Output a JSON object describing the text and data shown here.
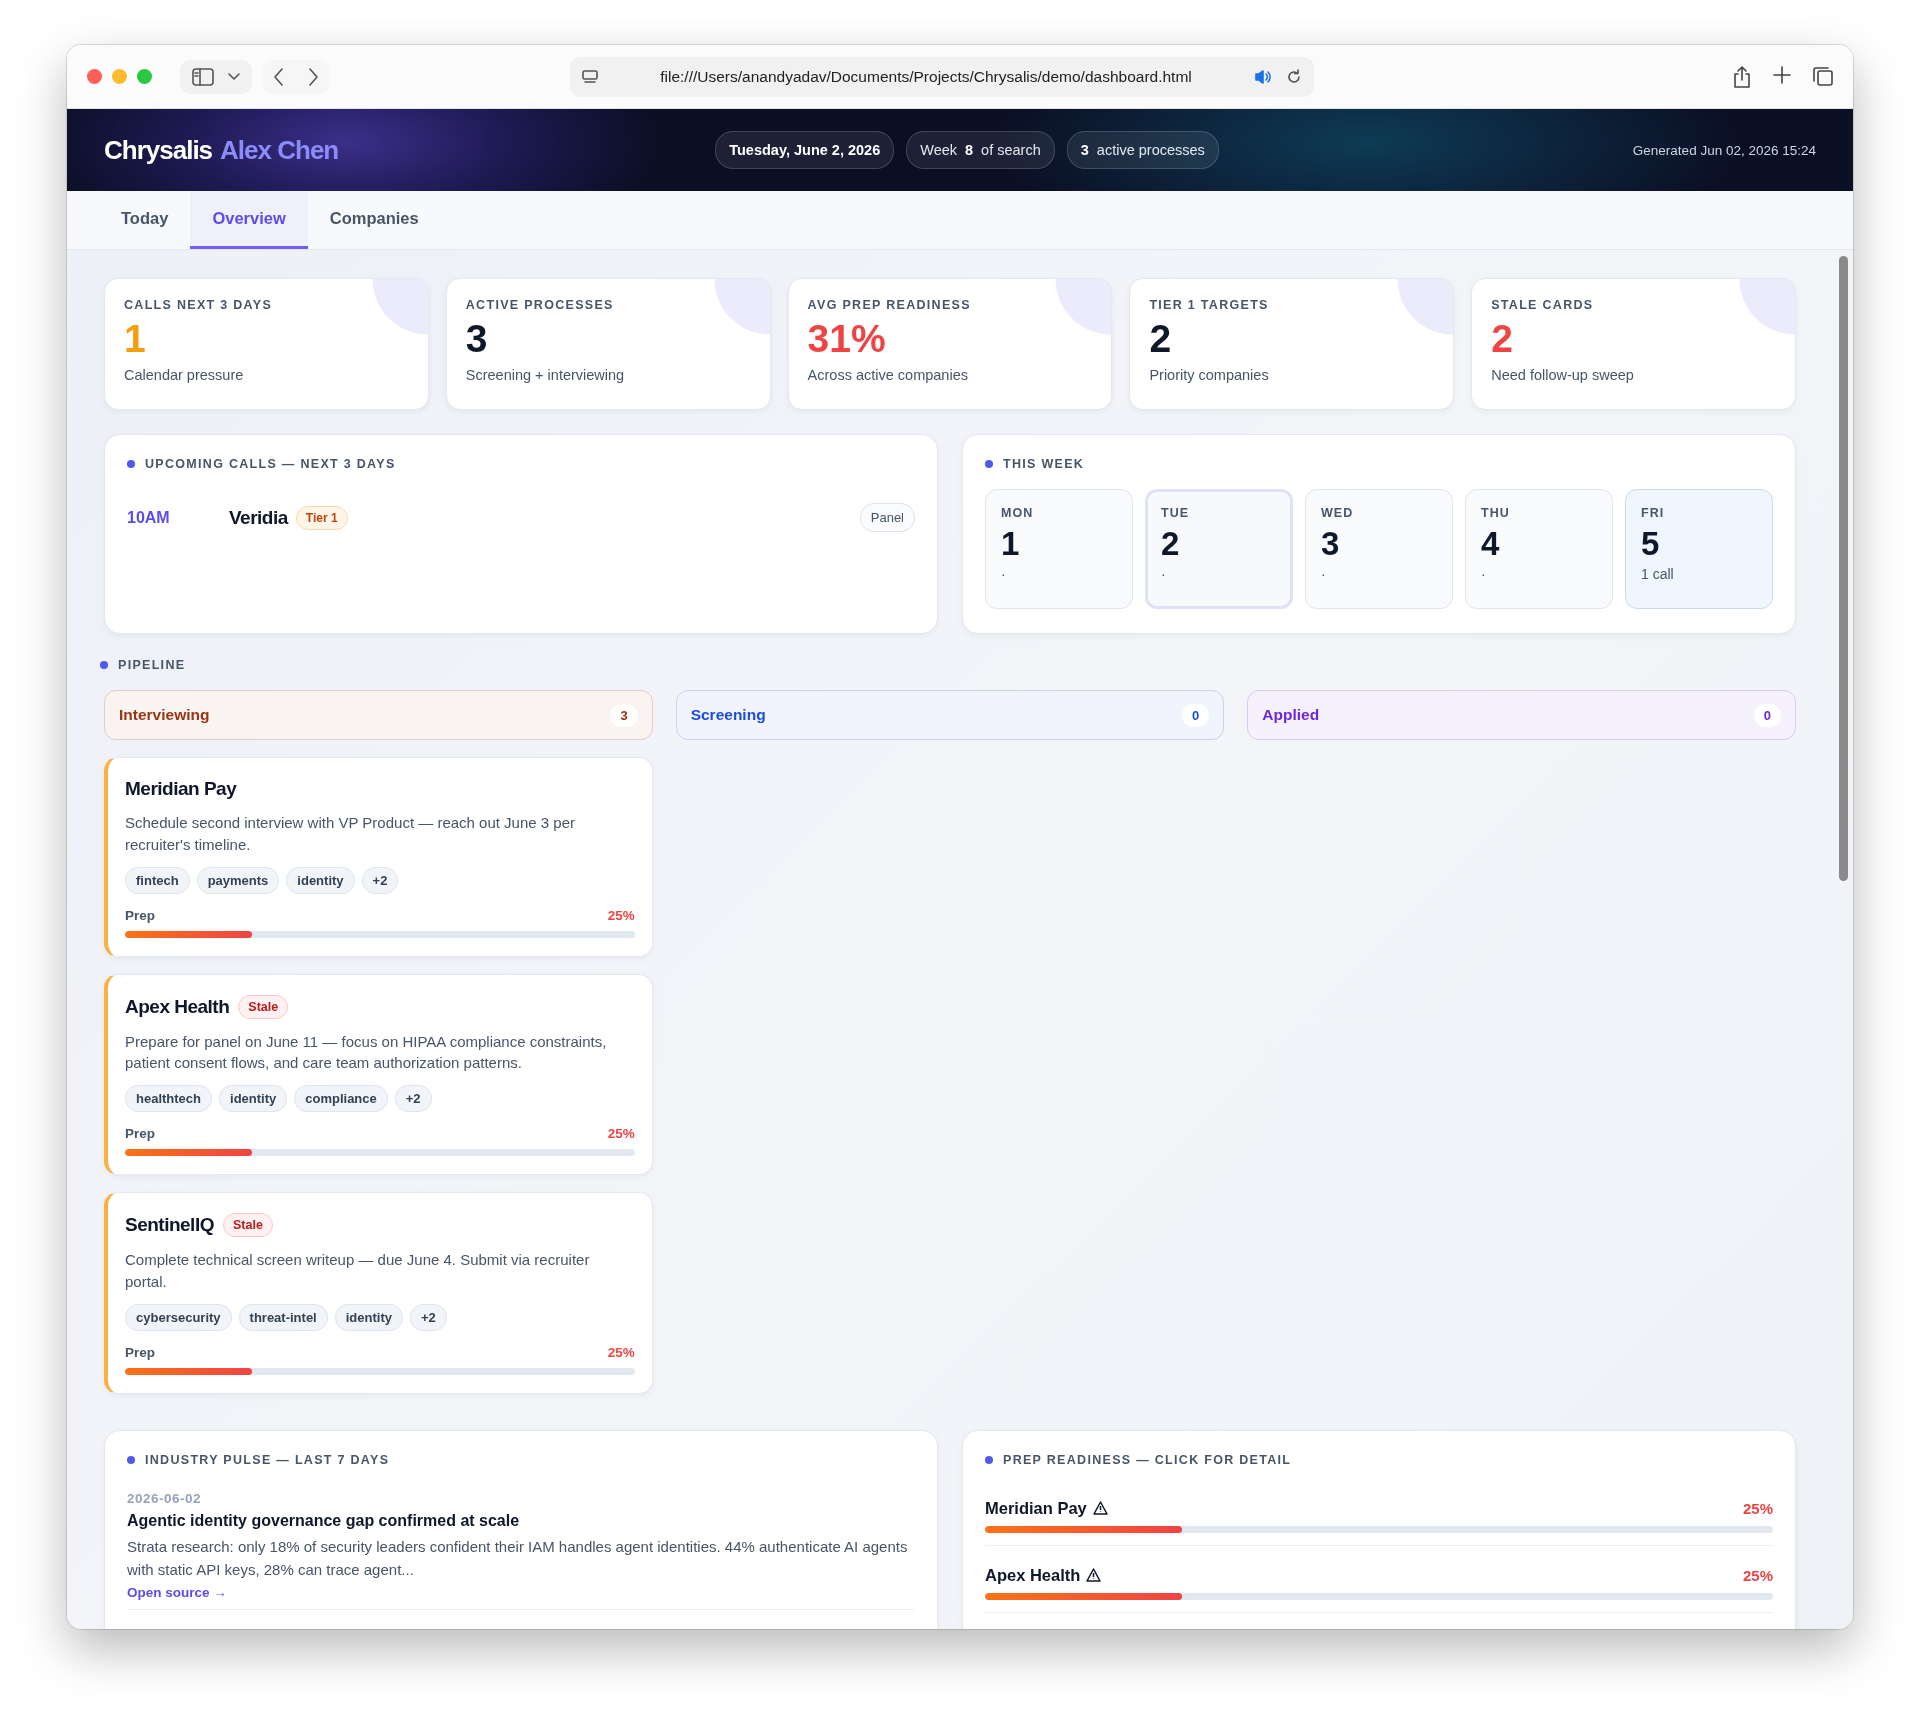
{
  "browser": {
    "url": "file:///Users/anandyadav/Documents/Projects/Chrysalis/demo/dashboard.html"
  },
  "header": {
    "brand": "Chrysalis",
    "user": "Alex Chen",
    "date": "Tuesday, June 2, 2026",
    "week": {
      "prefix": "Week",
      "number": "8",
      "suffix": "of search"
    },
    "processes": {
      "count": "3",
      "label": "active processes"
    },
    "generated": "Generated Jun 02, 2026 15:24"
  },
  "tabs": [
    {
      "label": "Today",
      "selected": false
    },
    {
      "label": "Overview",
      "selected": true
    },
    {
      "label": "Companies",
      "selected": false
    }
  ],
  "stats": [
    {
      "label": "CALLS NEXT 3 DAYS",
      "value": "1",
      "caption": "Calendar pressure",
      "color": "#f59e0b"
    },
    {
      "label": "ACTIVE PROCESSES",
      "value": "3",
      "caption": "Screening + interviewing",
      "color": "#0f172a"
    },
    {
      "label": "AVG PREP READINESS",
      "value": "31%",
      "caption": "Across active companies",
      "color": "#ef4444"
    },
    {
      "label": "TIER 1 TARGETS",
      "value": "2",
      "caption": "Priority companies",
      "color": "#0f172a"
    },
    {
      "label": "STALE CARDS",
      "value": "2",
      "caption": "Need follow-up sweep",
      "color": "#ef4444"
    }
  ],
  "upcoming": {
    "title": "UPCOMING CALLS — NEXT 3 DAYS",
    "calls": [
      {
        "time": "10AM",
        "company": "Veridia",
        "tier": "Tier 1",
        "type": "Panel"
      }
    ]
  },
  "week": {
    "title": "THIS WEEK",
    "days": [
      {
        "name": "MON",
        "number": "1",
        "note": "·",
        "kind": "plain"
      },
      {
        "name": "TUE",
        "number": "2",
        "note": "·",
        "kind": "today"
      },
      {
        "name": "WED",
        "number": "3",
        "note": "·",
        "kind": "plain"
      },
      {
        "name": "THU",
        "number": "4",
        "note": "·",
        "kind": "plain"
      },
      {
        "name": "FRI",
        "number": "5",
        "note": "1 call",
        "kind": "call"
      }
    ]
  },
  "pipeline": {
    "title": "PIPELINE",
    "columns": [
      {
        "name": "Interviewing",
        "count": "3",
        "color": "#9a3412",
        "cards": [
          {
            "name": "Meridian Pay",
            "description": "Schedule second interview with VP Product — reach out June 3 per recruiter's timeline.",
            "tags": [
              "fintech",
              "payments",
              "identity",
              "+2"
            ],
            "prep_label": "Prep",
            "prep_value": "25%",
            "level": 0.25
          },
          {
            "name": "Apex Health",
            "badge": "Stale",
            "description": "Prepare for panel on June 11 — focus on HIPAA compliance constraints, patient consent flows, and care team authorization patterns.",
            "tags": [
              "healthtech",
              "identity",
              "compliance",
              "+2"
            ],
            "prep_label": "Prep",
            "prep_value": "25%",
            "level": 0.25
          },
          {
            "name": "SentinelIQ",
            "badge": "Stale",
            "description": "Complete technical screen writeup — due June 4. Submit via recruiter portal.",
            "tags": [
              "cybersecurity",
              "threat-intel",
              "identity",
              "+2"
            ],
            "prep_label": "Prep",
            "prep_value": "25%",
            "level": 0.25
          }
        ]
      },
      {
        "name": "Screening",
        "count": "0",
        "color": "#1d4ed8"
      },
      {
        "name": "Applied",
        "count": "0",
        "color": "#6d28d9"
      }
    ]
  },
  "industry": {
    "title": "INDUSTRY PULSE — LAST 7 DAYS",
    "items": [
      {
        "date": "2026-06-02",
        "headline": "Agentic identity governance gap confirmed at scale",
        "summary": "Strata research: only 18% of security leaders confident their IAM handles agent identities. 44% authenticate AI agents with static API keys, 28% can trace agent...",
        "link": "Open source →"
      }
    ]
  },
  "readiness": {
    "title": "PREP READINESS — CLICK FOR DETAIL",
    "items": [
      {
        "name": "Meridian Pay",
        "warning": true,
        "value": "25%",
        "level": 0.25
      },
      {
        "name": "Apex Health",
        "warning": true,
        "value": "25%",
        "level": 0.25
      }
    ]
  }
}
